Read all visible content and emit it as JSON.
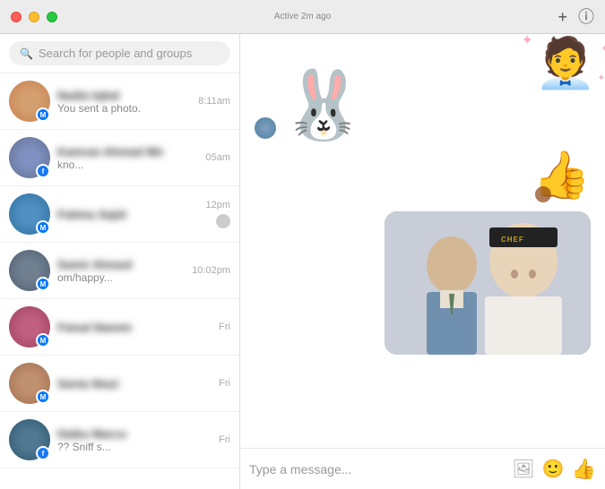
{
  "titlebar": {
    "status": "Active 2m ago",
    "compose_label": "✏",
    "add_label": "+",
    "info_label": "ⓘ"
  },
  "sidebar": {
    "search_placeholder": "Search for people and groups",
    "conversations": [
      {
        "id": 1,
        "name": "Nadia Iqbal",
        "preview": "You sent a photo.",
        "time": "8:11am",
        "avatar_class": "av-1",
        "badge": "messenger",
        "has_small_avatar": false
      },
      {
        "id": 2,
        "name": "Kamran Ahmad Mir",
        "preview": "kno...",
        "time": "05am",
        "avatar_class": "av-2",
        "badge": "facebook",
        "has_small_avatar": false
      },
      {
        "id": 3,
        "name": "Fatima Sajid",
        "preview": "",
        "time": "12pm",
        "avatar_class": "av-3",
        "badge": "messenger",
        "has_small_avatar": true
      },
      {
        "id": 4,
        "name": "Samir Ahmed",
        "preview": "om/happy...",
        "time": "10:02pm",
        "avatar_class": "av-4",
        "badge": "messenger",
        "has_small_avatar": false
      },
      {
        "id": 5,
        "name": "Faisal Naeem",
        "preview": "",
        "time": "Fri",
        "avatar_class": "av-5",
        "badge": "messenger",
        "has_small_avatar": false
      },
      {
        "id": 6,
        "name": "Sania Niazi",
        "preview": "",
        "time": "Fri",
        "avatar_class": "av-6",
        "badge": "messenger",
        "has_small_avatar": false
      },
      {
        "id": 7,
        "name": "Haiku Marco",
        "preview": "?? Sniff s...",
        "time": "Fri",
        "avatar_class": "av-7",
        "badge": "facebook",
        "has_small_avatar": false
      }
    ]
  },
  "chat": {
    "input_placeholder": "Type a message...",
    "chef_label": "CHEF"
  }
}
